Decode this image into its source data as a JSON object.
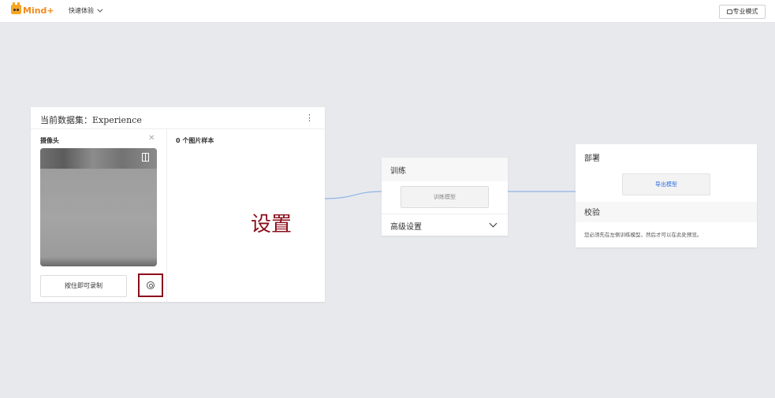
{
  "topbar": {
    "logo_text": "Mind+",
    "quick_experience": "快速体验",
    "pro_mode_button": "专业模式"
  },
  "dataset_card": {
    "title": "当前数据集：Experience",
    "camera_label": "摄像头",
    "record_button": "按住即可录制",
    "sample_count": "0 个图片样本"
  },
  "training_card": {
    "title": "训练",
    "train_button": "训练模型",
    "advanced_settings": "高级设置"
  },
  "deploy_card": {
    "title": "部署",
    "export_button": "导出模型",
    "validation_title": "校验",
    "validation_note": "您必须先在左侧训练模型，然后才可以在此处预览。"
  },
  "annotation": {
    "label": "设置",
    "color": "#8b0e1a"
  },
  "colors": {
    "background": "#e8e9ed",
    "connector": "#8fb4e8",
    "link_blue": "#2d6fe0"
  },
  "icons": {
    "kebab": "more-vertical-icon",
    "close": "close-icon",
    "flip": "flip-camera-icon",
    "settings": "gear-icon",
    "chevron": "chevron-down-icon",
    "lock": "lock-icon"
  }
}
